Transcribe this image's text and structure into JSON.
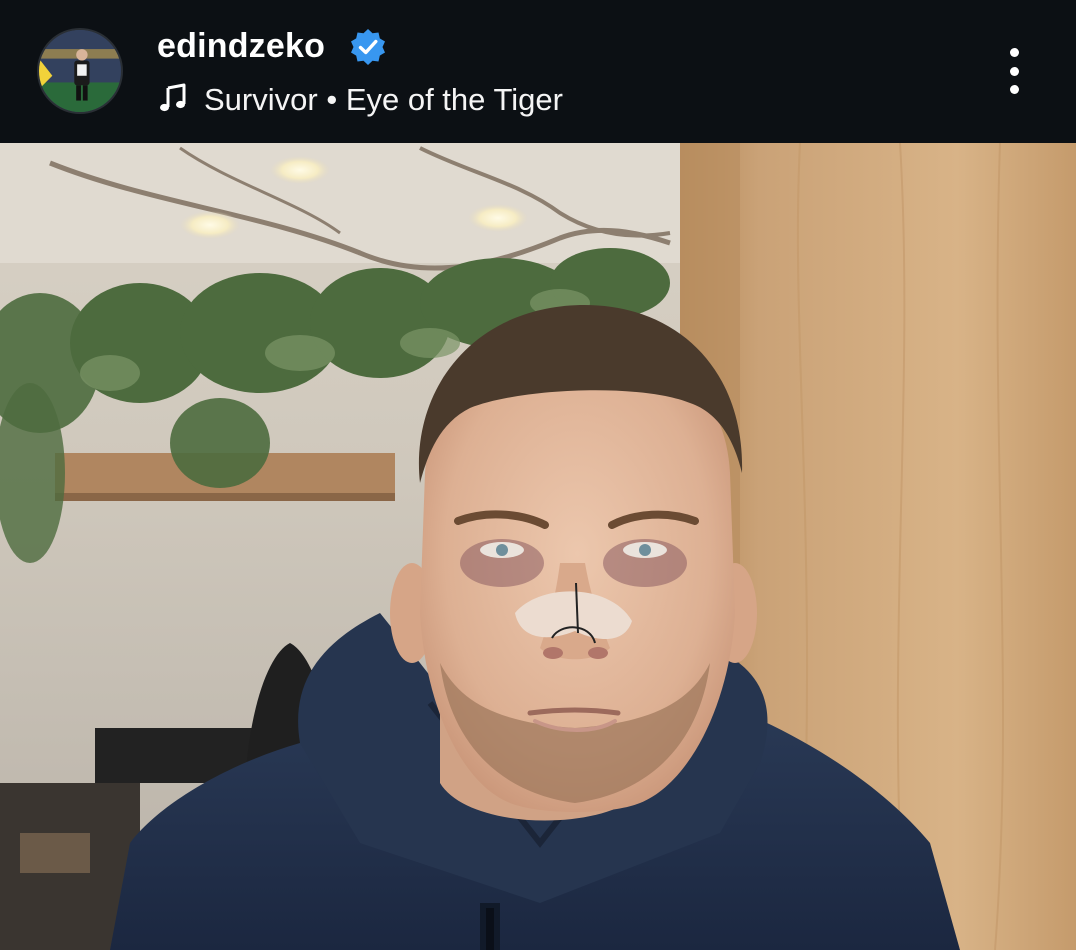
{
  "post": {
    "username": "edindzeko",
    "verified": true,
    "song": {
      "artist": "Survivor",
      "separator": "•",
      "title": "Eye of the Tiger"
    },
    "photo": {
      "description_icon": "photo-icon"
    }
  },
  "colors": {
    "background": "#0c1014",
    "verified_badge": "#3897f0",
    "text": "#ffffff"
  },
  "icons": {
    "verified": "verified-badge-icon",
    "music": "music-note-icon",
    "more": "more-options-icon"
  }
}
